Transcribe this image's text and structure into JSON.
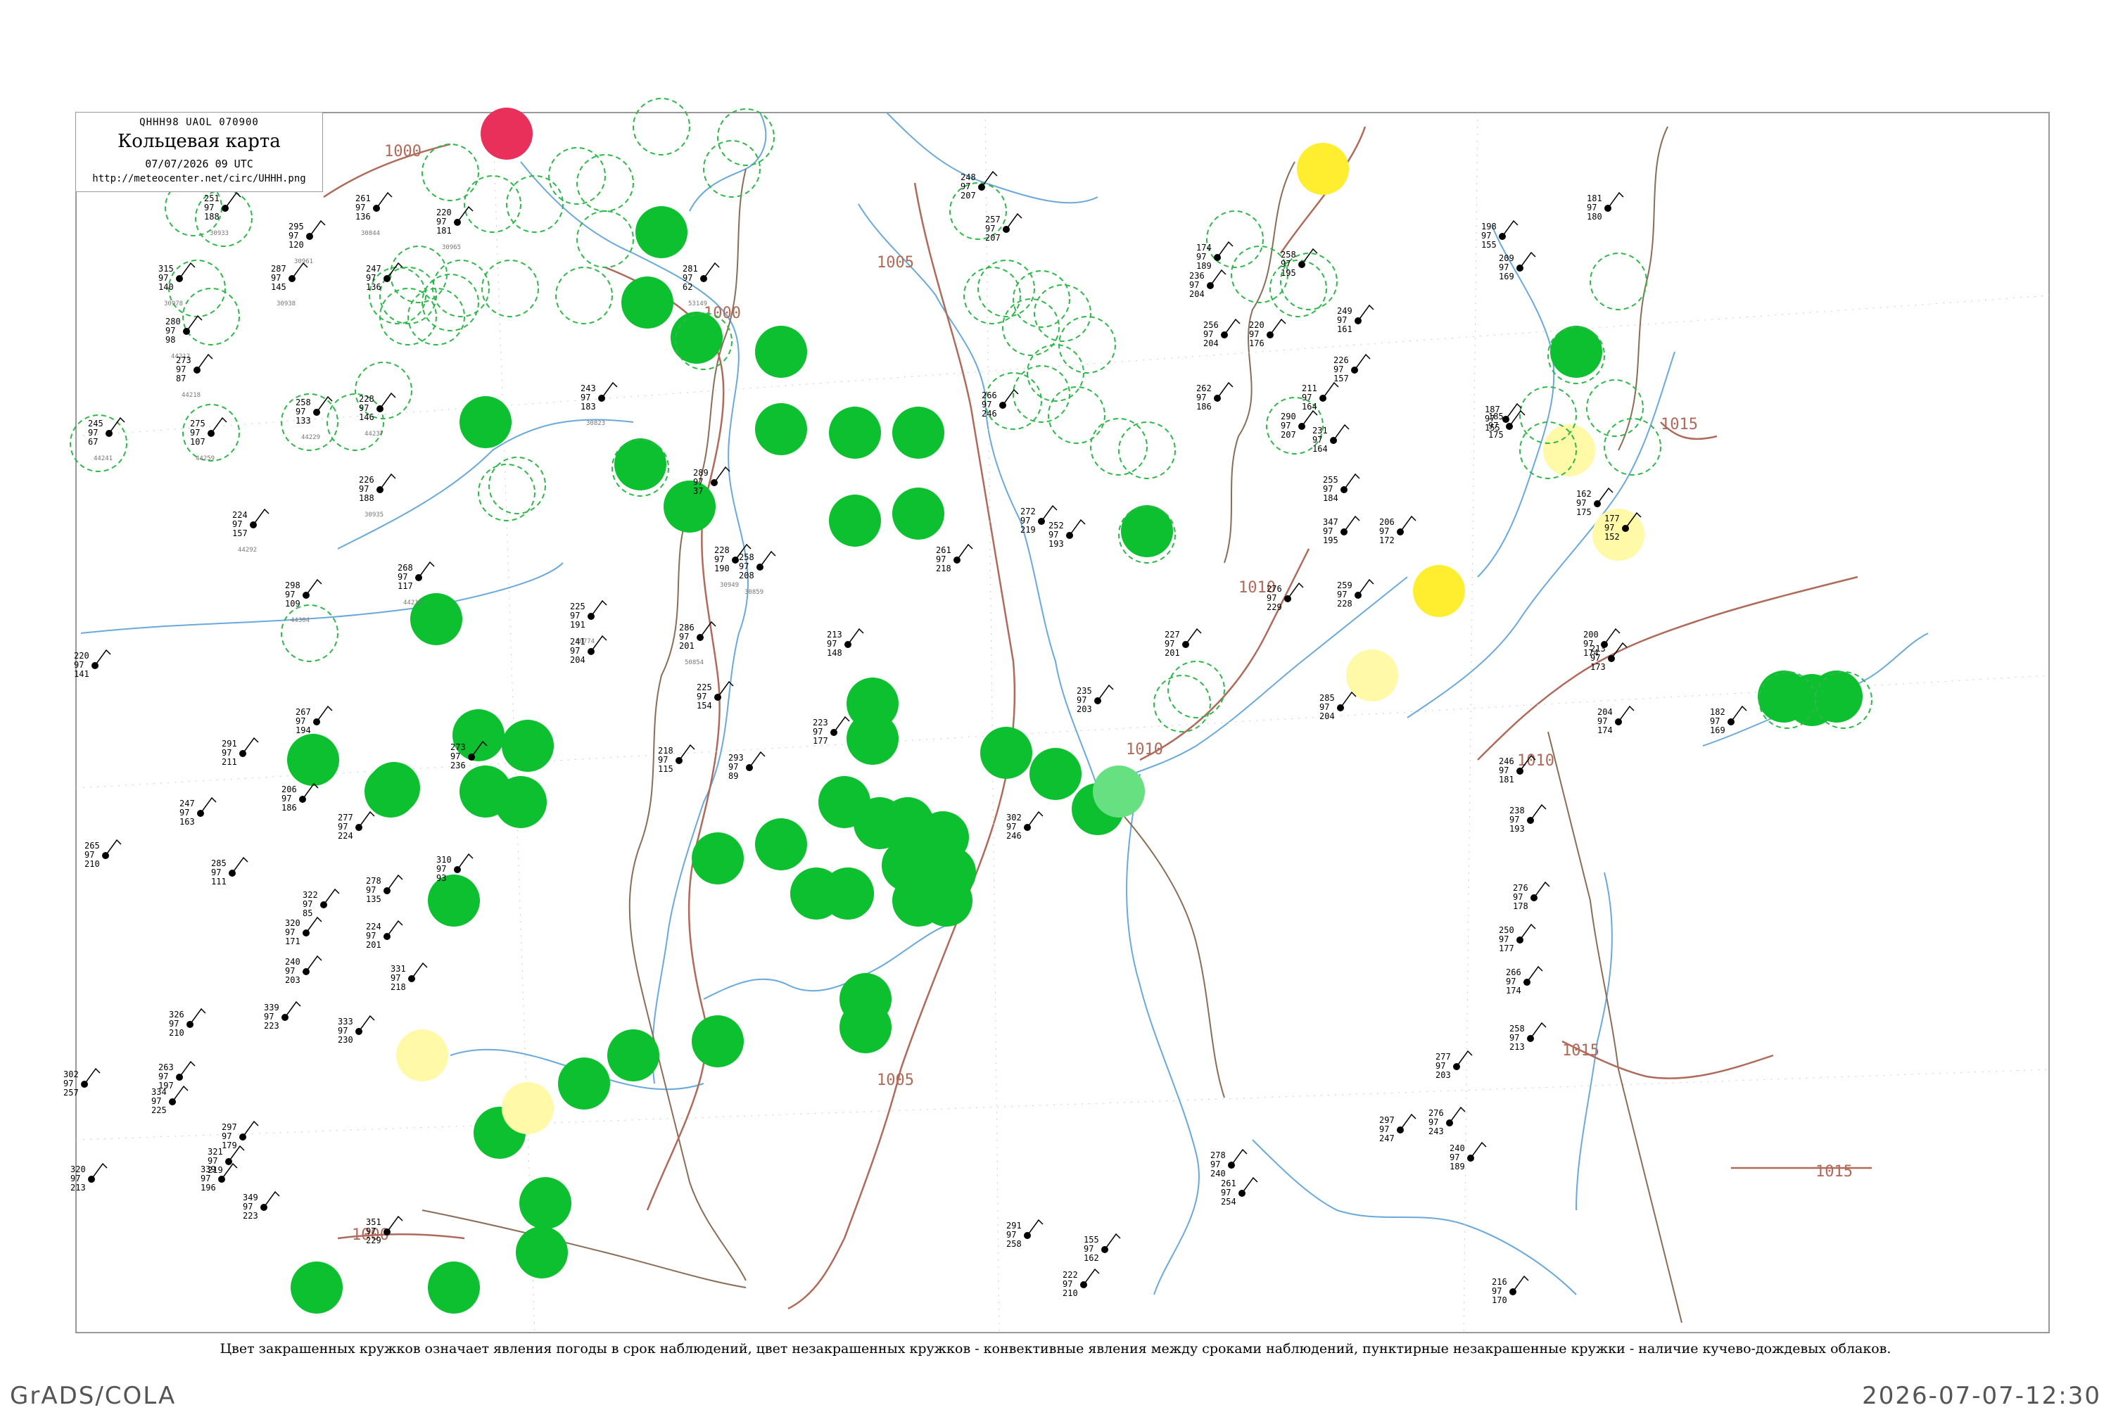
{
  "header": {
    "code": "QHHH98  UAOL  070900",
    "title": "Кольцевая карта",
    "datetime": "07/07/2026 09 UTC",
    "url": "http://meteocenter.net/circ/UHHH.png"
  },
  "caption": "Цвет закрашенных кружков означает явления погоды в срок наблюдений, цвет незакрашенных кружков - конвективные явления между сроками наблюдений, пунктирные незакрашенные кружки - наличие кучево-дождевых облаков.",
  "footer": {
    "left": "GrADS/COLA",
    "right": "2026-07-07-12:30"
  },
  "colors": {
    "isobar": "#b06a5a",
    "river": "#6aa9dc",
    "border": "#8a6d56",
    "rain": "#0cc030",
    "dashed_circle": "#2fb84a",
    "thunder_red": "#e8305a",
    "yellow": "#ffee30",
    "pale_yellow": "#fff9a8",
    "light_green": "#66e080"
  },
  "isobar_labels": [
    "1000",
    "1005",
    "1010",
    "1015"
  ],
  "stations": [
    {
      "text": [
        "251 ",
        "97",
        "188"
      ],
      "code": "30933"
    },
    {
      "text": [
        "295",
        "97",
        "120"
      ],
      "code": "30961"
    },
    {
      "text": [
        "261",
        "97",
        "136"
      ],
      "code": "30844"
    },
    {
      "text": [
        "220",
        "97",
        "181"
      ],
      "code": "30965"
    },
    {
      "text": [
        "315",
        "97",
        "140"
      ],
      "code": "30978"
    },
    {
      "text": [
        "287",
        "97",
        "145"
      ],
      "code": "30938"
    },
    {
      "text": [
        "247",
        "97",
        "136"
      ],
      "code": ""
    },
    {
      "text": [
        "280",
        "97",
        "98"
      ],
      "code": "44212"
    },
    {
      "text": [
        "273",
        "97",
        "87"
      ],
      "code": "44218"
    },
    {
      "text": [
        "258",
        "97",
        "133"
      ],
      "code": "44229"
    },
    {
      "text": [
        "228",
        "97",
        "146"
      ],
      "code": "44237"
    },
    {
      "text": [
        "245",
        "97",
        "67"
      ],
      "code": "44241"
    },
    {
      "text": [
        "275",
        "97",
        "107"
      ],
      "code": "44259"
    },
    {
      "text": [
        "243",
        "97",
        "183"
      ],
      "code": "30823"
    },
    {
      "text": [
        "226",
        "97",
        "188"
      ],
      "code": "30935"
    },
    {
      "text": [
        "224",
        "97",
        "157"
      ],
      "code": "44292"
    },
    {
      "text": [
        "298",
        "97",
        "109"
      ],
      "code": "44304"
    },
    {
      "text": [
        "268",
        "97",
        "117"
      ],
      "code": "44212"
    },
    {
      "text": [
        "220",
        "97",
        "141"
      ],
      "code": ""
    },
    {
      "text": [
        "281",
        "97",
        "62"
      ],
      "code": "53149"
    },
    {
      "text": [
        "289",
        "97",
        "37"
      ],
      "code": ""
    },
    {
      "text": [
        "228",
        "97",
        "190"
      ],
      "code": "30949"
    },
    {
      "text": [
        "258",
        "97",
        "208"
      ],
      "code": "30859"
    },
    {
      "text": [
        "261",
        "97",
        "218"
      ],
      "code": ""
    },
    {
      "text": [
        "272",
        "97",
        "219"
      ],
      "code": ""
    },
    {
      "text": [
        "286",
        "97",
        "201"
      ],
      "code": "50854"
    },
    {
      "text": [
        "225",
        "97",
        "191"
      ],
      "code": "50774"
    },
    {
      "text": [
        "241",
        "97",
        "204"
      ],
      "code": ""
    },
    {
      "text": [
        "225",
        "97",
        "154"
      ],
      "code": ""
    },
    {
      "text": [
        "213",
        "97",
        "148"
      ],
      "code": ""
    },
    {
      "text": [
        "223",
        "97",
        "177"
      ],
      "code": ""
    },
    {
      "text": [
        "267",
        "97",
        "194"
      ],
      "code": ""
    },
    {
      "text": [
        "291",
        "97",
        "211"
      ],
      "code": ""
    },
    {
      "text": [
        "273",
        "97",
        "236"
      ],
      "code": ""
    },
    {
      "text": [
        "218",
        "97",
        "115"
      ],
      "code": ""
    },
    {
      "text": [
        "293",
        "97",
        "89"
      ],
      "code": ""
    },
    {
      "text": [
        "206",
        "97",
        "186"
      ],
      "code": ""
    },
    {
      "text": [
        "247",
        "97",
        "163"
      ],
      "code": ""
    },
    {
      "text": [
        "265",
        "97",
        "210"
      ],
      "code": ""
    },
    {
      "text": [
        "277",
        "97",
        "224"
      ],
      "code": ""
    },
    {
      "text": [
        "285",
        "97",
        "111"
      ],
      "code": ""
    },
    {
      "text": [
        "310",
        "97",
        "93"
      ],
      "code": ""
    },
    {
      "text": [
        "322",
        "97",
        "85"
      ],
      "code": ""
    },
    {
      "text": [
        "278",
        "97",
        "135"
      ],
      "code": ""
    },
    {
      "text": [
        "320",
        "97",
        "171"
      ],
      "code": ""
    },
    {
      "text": [
        "240",
        "97",
        "203"
      ],
      "code": ""
    },
    {
      "text": [
        "224",
        "97",
        "201"
      ],
      "code": ""
    },
    {
      "text": [
        "331",
        "97",
        "218"
      ],
      "code": ""
    },
    {
      "text": [
        "339",
        "97",
        "223"
      ],
      "code": ""
    },
    {
      "text": [
        "326",
        "97",
        "210"
      ],
      "code": ""
    },
    {
      "text": [
        "263",
        "97",
        "197"
      ],
      "code": ""
    },
    {
      "text": [
        "334",
        "97",
        "225"
      ],
      "code": ""
    },
    {
      "text": [
        "302",
        "97",
        "257"
      ],
      "code": ""
    },
    {
      "text": [
        "297",
        "97",
        "179"
      ],
      "code": ""
    },
    {
      "text": [
        "321",
        "97",
        "219"
      ],
      "code": ""
    },
    {
      "text": [
        "320",
        "97",
        "213"
      ],
      "code": ""
    },
    {
      "text": [
        "339",
        "97",
        "196"
      ],
      "code": ""
    },
    {
      "text": [
        "349",
        "97",
        "223"
      ],
      "code": ""
    },
    {
      "text": [
        "351",
        "97",
        "229"
      ],
      "code": ""
    },
    {
      "text": [
        "333",
        "97",
        "230"
      ],
      "code": ""
    },
    {
      "text": [
        "302",
        "97",
        "246"
      ],
      "code": ""
    },
    {
      "text": [
        "266",
        "97",
        "246"
      ],
      "code": ""
    },
    {
      "text": [
        "248",
        "97",
        "207"
      ],
      "code": ""
    },
    {
      "text": [
        "257",
        "97",
        "207"
      ],
      "code": ""
    },
    {
      "text": [
        "174",
        "97",
        "189"
      ],
      "code": ""
    },
    {
      "text": [
        "256",
        "97",
        "204"
      ],
      "code": ""
    },
    {
      "text": [
        "262",
        "97",
        "186"
      ],
      "code": ""
    },
    {
      "text": [
        "290",
        "97",
        "207"
      ],
      "code": ""
    },
    {
      "text": [
        "252",
        "97",
        "193"
      ],
      "code": ""
    },
    {
      "text": [
        "235",
        "97",
        "203"
      ],
      "code": ""
    },
    {
      "text": [
        "227",
        "97",
        "201"
      ],
      "code": ""
    },
    {
      "text": [
        "258",
        "97",
        "195"
      ],
      "code": ""
    },
    {
      "text": [
        "236",
        "97",
        "204"
      ],
      "code": ""
    },
    {
      "text": [
        "249",
        "97",
        "161"
      ],
      "code": ""
    },
    {
      "text": [
        "220",
        "97",
        "176"
      ],
      "code": ""
    },
    {
      "text": [
        "226",
        "97",
        "157"
      ],
      "code": ""
    },
    {
      "text": [
        "211",
        "97",
        "164"
      ],
      "code": ""
    },
    {
      "text": [
        "231",
        "97",
        "164"
      ],
      "code": ""
    },
    {
      "text": [
        "255",
        "97",
        "184"
      ],
      "code": ""
    },
    {
      "text": [
        "347",
        "97",
        "195"
      ],
      "code": ""
    },
    {
      "text": [
        "259",
        "97",
        "228"
      ],
      "code": ""
    },
    {
      "text": [
        "206",
        "97",
        "172"
      ],
      "code": ""
    },
    {
      "text": [
        "276",
        "97",
        "229"
      ],
      "code": ""
    },
    {
      "text": [
        "285",
        "97",
        "204"
      ],
      "code": ""
    },
    {
      "text": [
        "185",
        "97",
        "175"
      ],
      "code": ""
    },
    {
      "text": [
        "187",
        "97",
        "155"
      ],
      "code": ""
    },
    {
      "text": [
        "209",
        "97",
        "169"
      ],
      "code": ""
    },
    {
      "text": [
        "198",
        "97",
        "155"
      ],
      "code": ""
    },
    {
      "text": [
        "181",
        "97",
        "180"
      ],
      "code": ""
    },
    {
      "text": [
        "162",
        "97",
        "175"
      ],
      "code": ""
    },
    {
      "text": [
        "177",
        "97",
        "152"
      ],
      "code": ""
    },
    {
      "text": [
        "200",
        "97",
        "174"
      ],
      "code": ""
    },
    {
      "text": [
        "213",
        "97",
        "173"
      ],
      "code": ""
    },
    {
      "text": [
        "204",
        "97",
        "174"
      ],
      "code": ""
    },
    {
      "text": [
        "246",
        "97",
        "181"
      ],
      "code": ""
    },
    {
      "text": [
        "238",
        "97",
        "193"
      ],
      "code": ""
    },
    {
      "text": [
        "276",
        "97",
        "178"
      ],
      "code": ""
    },
    {
      "text": [
        "250",
        "97",
        "177"
      ],
      "code": ""
    },
    {
      "text": [
        "266",
        "97",
        "174"
      ],
      "code": ""
    },
    {
      "text": [
        "258",
        "97",
        "213"
      ],
      "code": ""
    },
    {
      "text": [
        "277",
        "97",
        "203"
      ],
      "code": ""
    },
    {
      "text": [
        "240",
        "97",
        "189"
      ],
      "code": ""
    },
    {
      "text": [
        "276",
        "97",
        "243"
      ],
      "code": ""
    },
    {
      "text": [
        "297",
        "97",
        "247"
      ],
      "code": ""
    },
    {
      "text": [
        "278",
        "97",
        "240"
      ],
      "code": ""
    },
    {
      "text": [
        "261",
        "97",
        "254"
      ],
      "code": ""
    },
    {
      "text": [
        "291",
        "97",
        "258"
      ],
      "code": ""
    },
    {
      "text": [
        "222",
        "97",
        "210"
      ],
      "code": ""
    },
    {
      "text": [
        "155",
        "97",
        "162"
      ],
      "code": ""
    },
    {
      "text": [
        "216",
        "97",
        "170"
      ],
      "code": ""
    },
    {
      "text": [
        "182",
        "97",
        "169"
      ],
      "code": ""
    }
  ]
}
